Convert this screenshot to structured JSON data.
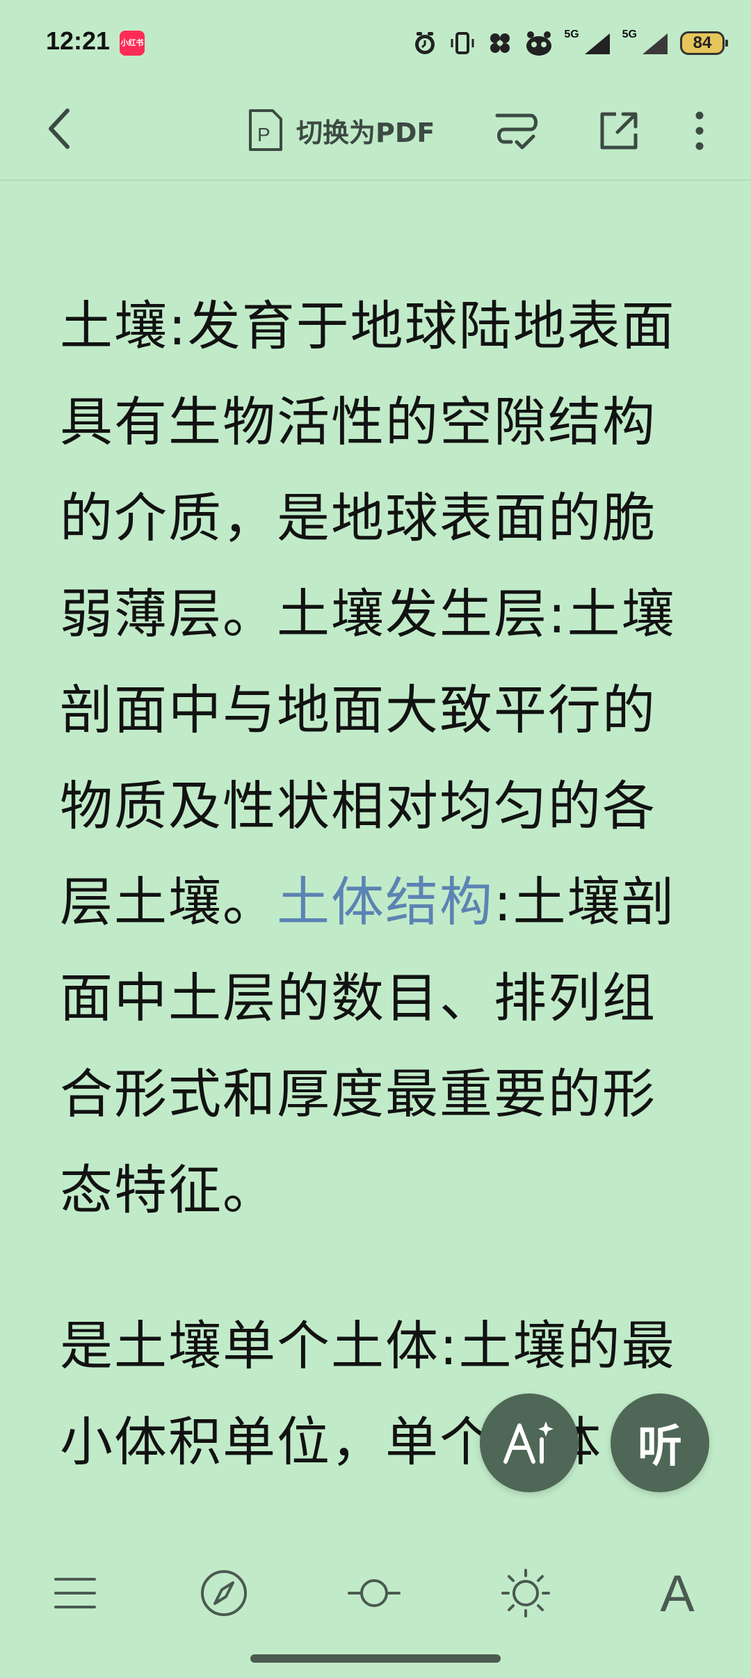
{
  "status_bar": {
    "time": "12:21",
    "app_badge": "小红书",
    "signal_1": "5G",
    "signal_2": "5G",
    "battery": "84"
  },
  "toolbar": {
    "pdf_label": "切换为PDF"
  },
  "content": {
    "para1_a": "土壤:发育于地球陆地表面具有生物活性的空隙结构的介质，是地球表面的脆弱薄层。土壤发生层:土壤剖面中与地面大致平行的物质及性状相对均匀的各层土壤。",
    "para1_link": "土体结构",
    "para1_b": ":土壤剖面中土层的数目、排列组合形式和厚度最重要的形态特征。",
    "para2": "是土壤单个土体:土壤的最小体积单位，单个土体"
  },
  "fab": {
    "ai_label": "AI",
    "listen_label": "听"
  },
  "bottom_bar": {
    "font_label": "A"
  },
  "colors": {
    "background": "#c1ebc8",
    "link": "#5b83b4",
    "fab": "#4f6756"
  }
}
